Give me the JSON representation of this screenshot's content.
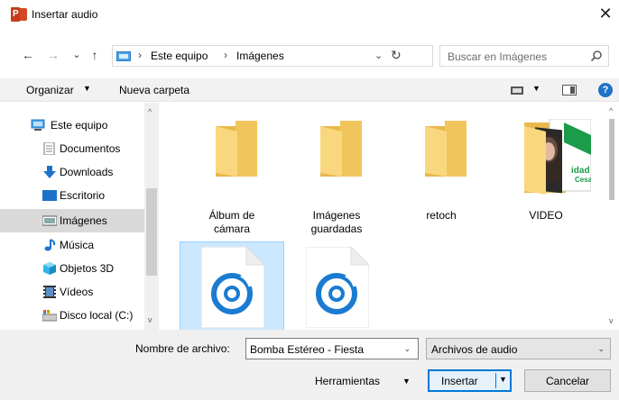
{
  "window": {
    "title": "Insertar audio",
    "app_icon_letter": "P",
    "close_glyph": "✕"
  },
  "address_bar": {
    "back_glyph": "←",
    "forward_glyph": "→",
    "recent_glyph": "⌄",
    "up_glyph": "↑",
    "separator": "›",
    "crumbs": [
      "Este equipo",
      "Imágenes"
    ],
    "dropdown_glyph": "⌄",
    "refresh_glyph": "↻"
  },
  "search": {
    "placeholder": "Buscar en Imágenes"
  },
  "toolbar": {
    "organize_label": "Organizar",
    "organize_caret": "▼",
    "new_folder_label": "Nueva carpeta",
    "view_caret": "▼",
    "help_glyph": "?"
  },
  "nav_pane": {
    "items": [
      {
        "label": "Este equipo",
        "icon": "computer-icon"
      },
      {
        "label": "Documentos",
        "icon": "documents-icon"
      },
      {
        "label": "Downloads",
        "icon": "downloads-icon"
      },
      {
        "label": "Escritorio",
        "icon": "desktop-icon"
      },
      {
        "label": "Imágenes",
        "icon": "pictures-icon",
        "selected": true
      },
      {
        "label": "Música",
        "icon": "music-icon"
      },
      {
        "label": "Objetos 3D",
        "icon": "objects-3d-icon"
      },
      {
        "label": "Vídeos",
        "icon": "videos-icon"
      },
      {
        "label": "Disco local (C:)",
        "icon": "local-disk-icon"
      }
    ],
    "scroll_up": "^",
    "scroll_down": "v"
  },
  "files": {
    "items": [
      {
        "label_line1": "Álbum de",
        "label_line2": "cámara",
        "type": "folder"
      },
      {
        "label_line1": "Imágenes",
        "label_line2": "guardadas",
        "type": "folder"
      },
      {
        "label_line1": "retoch",
        "label_line2": "",
        "type": "folder"
      },
      {
        "label_line1": "VIDEO",
        "label_line2": "",
        "type": "folder-with-preview"
      },
      {
        "label_line1": "",
        "label_line2": "",
        "type": "audio",
        "selected": true
      },
      {
        "label_line1": "",
        "label_line2": "",
        "type": "audio"
      }
    ],
    "scroll_up": "^",
    "scroll_down": "v"
  },
  "bottom": {
    "filename_label": "Nombre de archivo:",
    "filename_value": "Bomba Estéreo - Fiesta",
    "filename_caret": "⌄",
    "filetype_value": "Archivos de audio",
    "filetype_caret": "⌄",
    "tools_label": "Herramientas",
    "tools_caret": "▼",
    "insert_label": "Insertar",
    "insert_drop": "▼",
    "cancel_label": "Cancelar"
  },
  "colors": {
    "accent": "#0078d7",
    "folder": "#f9d77e",
    "folder_dark": "#e8b84b",
    "audio_ring": "#1a7bd1",
    "selection": "#cce8ff"
  }
}
